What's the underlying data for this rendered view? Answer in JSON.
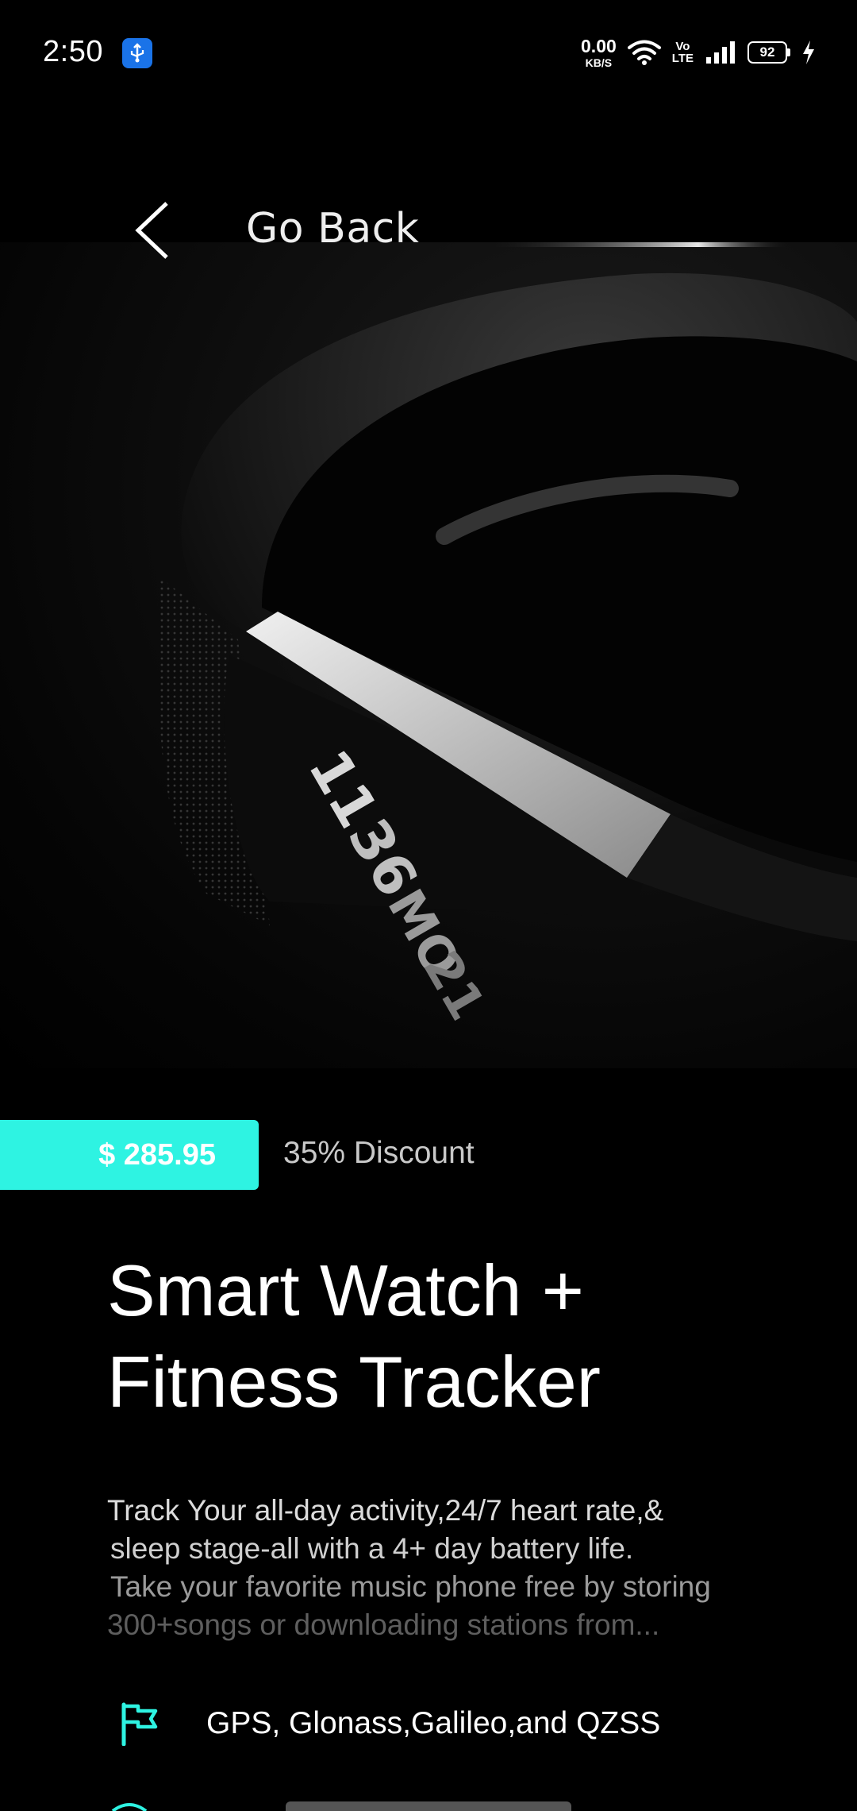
{
  "status_bar": {
    "time": "2:50",
    "net_speed_value": "0.00",
    "net_speed_unit": "KB/S",
    "volte_top": "Vo",
    "volte_bottom": "LTE",
    "battery_level": "92"
  },
  "header": {
    "back_label": "Go Back"
  },
  "hero_image": {
    "watch_display_lines": [
      "11",
      "36",
      "MO",
      "21"
    ]
  },
  "product": {
    "price": "$ 285.95",
    "discount": "35% Discount",
    "title_lines": [
      "Smart Watch +",
      "Fitness Tracker"
    ],
    "description_lines": [
      "Track Your all-day activity,24/7 heart rate,&",
      "sleep stage-all with a 4+ day battery life.",
      "Take your favorite music phone free by storing",
      "300+songs or downloading stations from..."
    ],
    "features": [
      {
        "icon": "flag-icon",
        "label": "GPS, Glonass,Galileo,and QZSS"
      }
    ]
  },
  "colors": {
    "accent": "#2ef3e2",
    "background": "#000000"
  }
}
